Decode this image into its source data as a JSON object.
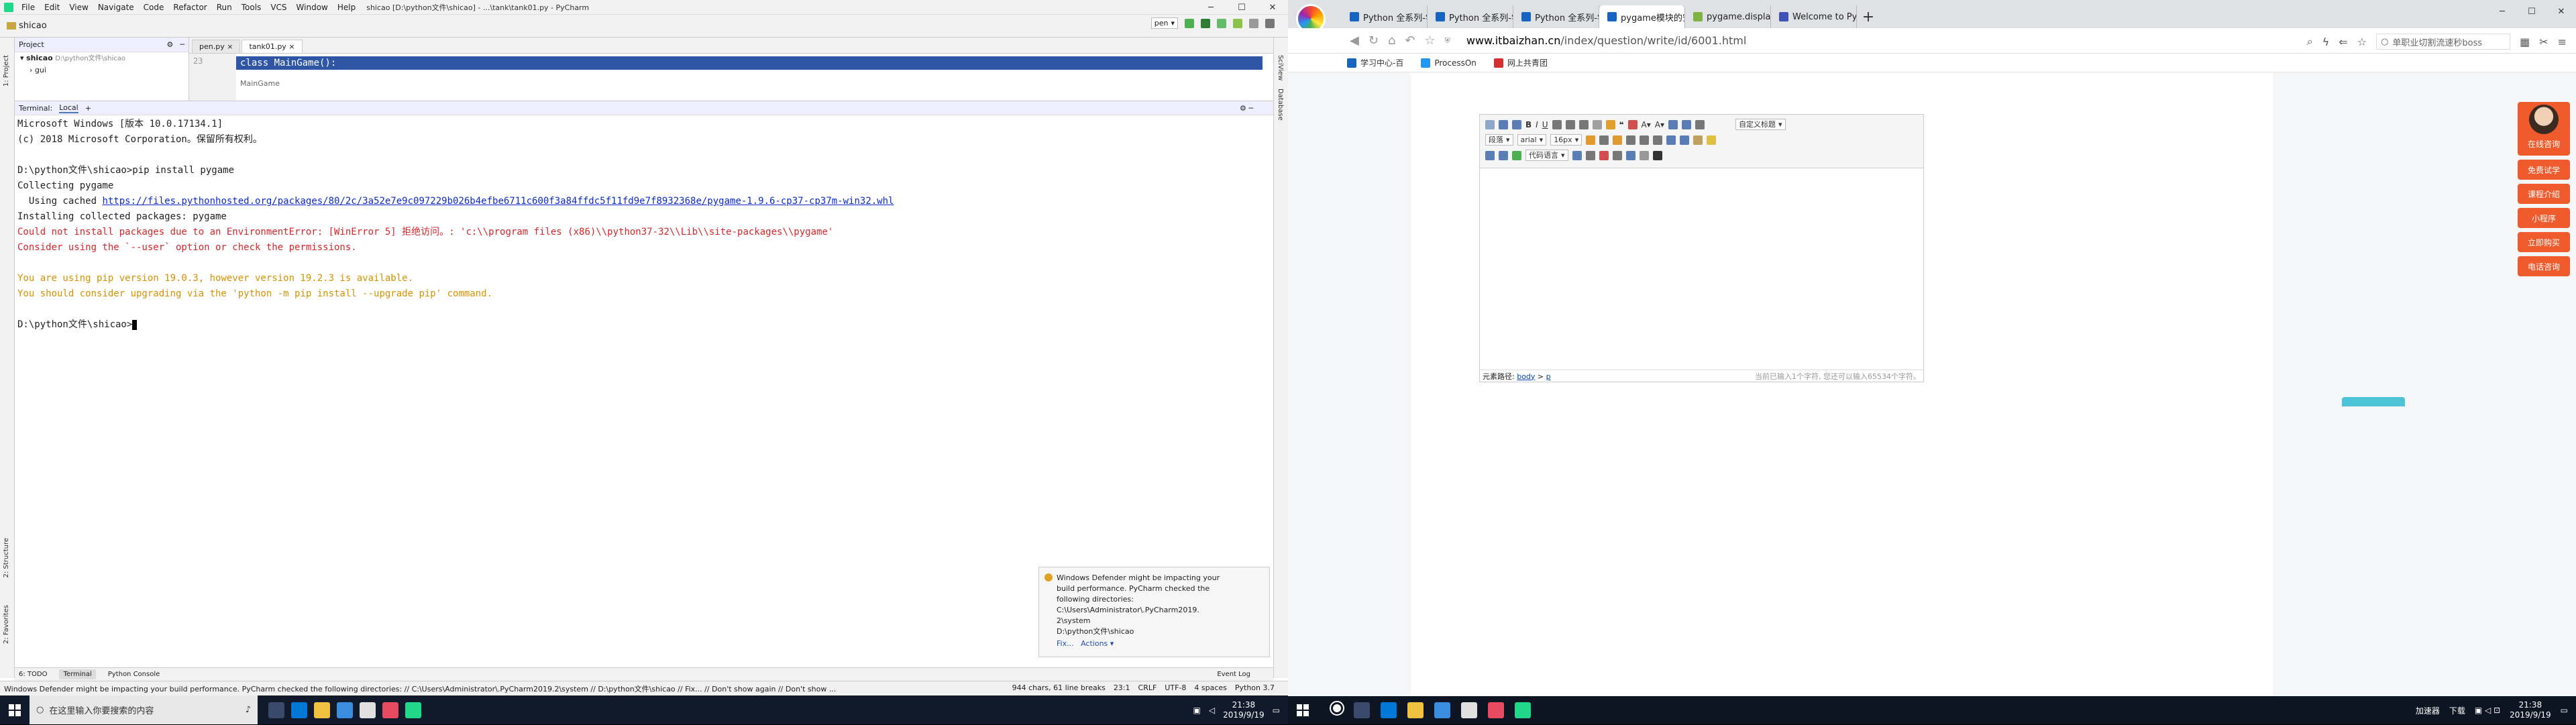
{
  "pycharm": {
    "title": "shicao [D:\\python文件\\shicao] - ...\\tank\\tank01.py - PyCharm",
    "menu": [
      "File",
      "Edit",
      "View",
      "Navigate",
      "Code",
      "Refactor",
      "Run",
      "Tools",
      "VCS",
      "Window",
      "Help"
    ],
    "nav_project": "shicao",
    "run_config": "pen",
    "project_panel": {
      "header": "Project",
      "root": "shicao",
      "root_path": "D:\\python文件\\shicao",
      "items": [
        "gui"
      ]
    },
    "editor_tabs": [
      "pen.py",
      "tank01.py"
    ],
    "editor": {
      "line_number": "23",
      "code": "class MainGame():",
      "breadcrumb": "MainGame"
    },
    "terminal": {
      "header": "Terminal:",
      "tab": "Local",
      "lines": [
        {
          "t": "Microsoft Windows [版本 10.0.17134.1]",
          "c": ""
        },
        {
          "t": "(c) 2018 Microsoft Corporation。保留所有权利。",
          "c": ""
        },
        {
          "t": "",
          "c": ""
        },
        {
          "t": "D:\\python文件\\shicao>pip install pygame",
          "c": ""
        },
        {
          "t": "Collecting pygame",
          "c": ""
        },
        {
          "t": "  Using cached ",
          "c": "",
          "link": "https://files.pythonhosted.org/packages/80/2c/3a52e7e9c097229b026b4efbe6711c600f3a84ffdc5f11fd9e7f8932368e/pygame-1.9.6-cp37-cp37m-win32.whl"
        },
        {
          "t": "Installing collected packages: pygame",
          "c": ""
        },
        {
          "t": "Could not install packages due to an EnvironmentError: [WinError 5] 拒绝访问。: 'c:\\\\program files (x86)\\\\python37-32\\\\Lib\\\\site-packages\\\\pygame'",
          "c": "red"
        },
        {
          "t": "Consider using the `--user` option or check the permissions.",
          "c": "red"
        },
        {
          "t": "",
          "c": ""
        },
        {
          "t": "You are using pip version 19.0.3, however version 19.2.3 is available.",
          "c": "orange"
        },
        {
          "t": "You should consider upgrading via the 'python -m pip install --upgrade pip' command.",
          "c": "orange"
        },
        {
          "t": "",
          "c": ""
        },
        {
          "t": "D:\\python文件\\shicao>",
          "c": "",
          "cursor": true
        }
      ]
    },
    "notification": {
      "lines": [
        "Windows Defender might be impacting your",
        "build performance. PyCharm checked the",
        "following directories:",
        "C:\\Users\\Administrator\\.PyCharm2019.",
        "2\\system",
        "D:\\python文件\\shicao"
      ],
      "fix": "Fix...",
      "actions": "Actions ▾"
    },
    "bottom_tabs": [
      "6: TODO",
      "Terminal",
      "Python Console"
    ],
    "event_log": "Event Log",
    "side_tabs_left": [
      "1: Project",
      "2: Structure",
      "2: Favorites"
    ],
    "side_tabs_right": [
      "SciView",
      "Database"
    ],
    "status_text": "Windows Defender might be impacting your build performance. PyCharm checked the following directories: // C:\\Users\\Administrator\\.PyCharm2019.2\\system // D:\\python文件\\shicao // Fix... // Don't show again // Don't show ... (moments ago)",
    "status_right": [
      "944 chars, 61 line breaks",
      "23:1",
      "CRLF",
      "UTF-8",
      "4 spaces",
      "Python 3.7"
    ],
    "taskbar_search": "在这里输入你要搜索的内容",
    "clock_time": "21:38",
    "clock_date": "2019/9/19"
  },
  "browser": {
    "tabs": [
      {
        "label": "Python 全系列-学习",
        "color": "#1565c0"
      },
      {
        "label": "Python 全系列-学习",
        "color": "#1565c0"
      },
      {
        "label": "Python 全系列-学习",
        "color": "#1565c0"
      },
      {
        "label": "pygame模块的安装",
        "color": "#1565c0"
      },
      {
        "label": "pygame.display —",
        "color": "#7cb342"
      },
      {
        "label": "Welcome to Pytho",
        "color": "#3f51b5"
      }
    ],
    "url_domain": "www.itbaizhan.cn",
    "url_path": "/index/question/write/id/6001.html",
    "search_text": "单职业切割流速秒boss",
    "bookmarks": [
      "学习中心-百",
      "ProcessOn",
      "网上共青团"
    ],
    "editor_fonts": {
      "format": "段落",
      "font": "arial",
      "size": "16px",
      "code_lang": "代码语言",
      "custom_title": "自定义标题"
    },
    "element_path_label": "元素路径:",
    "element_path": [
      "body",
      "p"
    ],
    "char_count": "当前已输入1个字符, 您还可以输入65534个字符。",
    "sidebar_buttons": [
      "在线咨询",
      "免费试学",
      "课程介绍",
      "小程序",
      "立即购买",
      "电话咨询"
    ],
    "tray_labels": [
      "加速器",
      "下载"
    ],
    "clock_time": "21:38",
    "clock_date": "2019/9/19"
  }
}
